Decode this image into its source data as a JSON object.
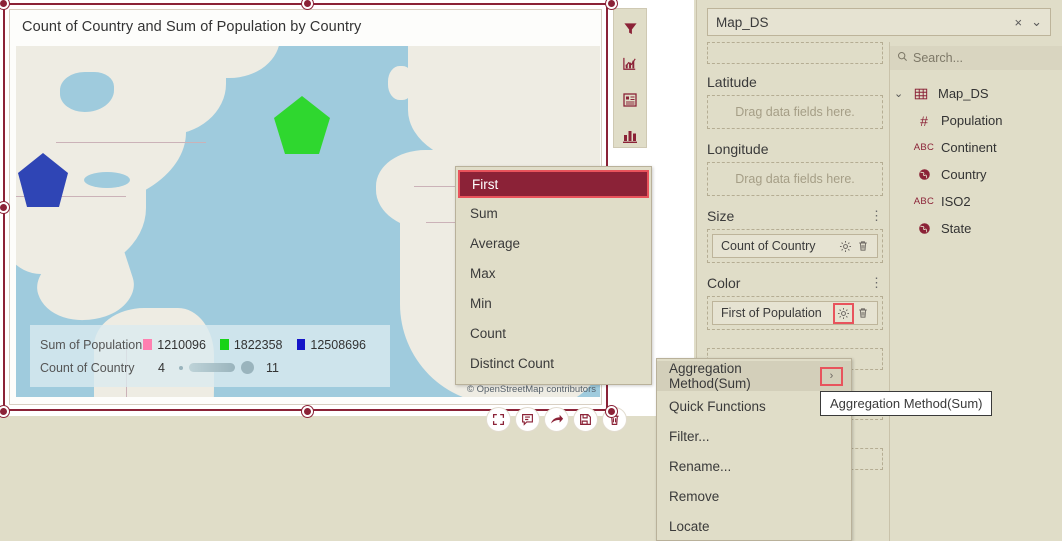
{
  "widget": {
    "title": "Count of Country and Sum of Population by Country",
    "map_attribution": "© OpenStreetMap contributors",
    "legend": {
      "color_label": "Sum of Population",
      "color_items": [
        {
          "color": "#ff7fb0",
          "value": "1210096"
        },
        {
          "color": "#17d317",
          "value": "1822358"
        },
        {
          "color": "#1414c8",
          "value": "12508696"
        }
      ],
      "size_label": "Count of Country",
      "size_min": "4",
      "size_max": "11"
    },
    "markers": [
      {
        "name": "united-states-marker",
        "color": "#2f45b5"
      },
      {
        "name": "europe-marker",
        "color": "#2fd72f"
      }
    ],
    "toolbar": [
      {
        "name": "expand-button",
        "glyph": "⛶"
      },
      {
        "name": "comment-button",
        "glyph": "▭"
      },
      {
        "name": "share-button",
        "glyph": "➜"
      },
      {
        "name": "save-button",
        "glyph": "▤"
      },
      {
        "name": "delete-button",
        "glyph": "🗑"
      }
    ]
  },
  "side_strip": [
    {
      "name": "filter-icon",
      "label": "Filter"
    },
    {
      "name": "chart-settings-icon",
      "label": "Chart settings"
    },
    {
      "name": "properties-icon",
      "label": "Properties"
    },
    {
      "name": "bar-chart-icon",
      "label": "Chart type"
    }
  ],
  "panel": {
    "dataset_select": {
      "value": "Map_DS",
      "clear": "×",
      "chevron": "⌄"
    },
    "shelves": [
      {
        "name": "geography",
        "label": "",
        "placeholder": "",
        "type": "empty-strip"
      },
      {
        "name": "latitude",
        "label": "Latitude",
        "placeholder": "Drag data fields here.",
        "type": "empty"
      },
      {
        "name": "longitude",
        "label": "Longitude",
        "placeholder": "Drag data fields here.",
        "type": "empty"
      },
      {
        "name": "size",
        "label": "Size",
        "pill": "Count of Country",
        "type": "filled",
        "highlight": false
      },
      {
        "name": "color",
        "label": "Color",
        "pill": "First of Population",
        "type": "filled",
        "highlight": true
      }
    ],
    "kebab": "⋮",
    "gear": "⚙",
    "trash": "🗑",
    "search": {
      "placeholder": "Search...",
      "icon": "search-icon"
    },
    "tree": {
      "root": {
        "label": "Map_DS",
        "icon": "table-icon",
        "chevron": "⌄"
      },
      "fields": [
        {
          "label": "Population",
          "icon": "number-icon",
          "glyph": "#"
        },
        {
          "label": "Continent",
          "icon": "text-icon",
          "glyph": "ABC"
        },
        {
          "label": "Country",
          "icon": "geo-icon",
          "glyph": "globe"
        },
        {
          "label": "ISO2",
          "icon": "text-icon",
          "glyph": "ABC"
        },
        {
          "label": "State",
          "icon": "geo-icon",
          "glyph": "globe"
        }
      ]
    }
  },
  "aggregation_menu": {
    "items": [
      {
        "label": "First",
        "selected": true
      },
      {
        "label": "Sum",
        "selected": false
      },
      {
        "label": "Average",
        "selected": false
      },
      {
        "label": "Max",
        "selected": false
      },
      {
        "label": "Min",
        "selected": false
      },
      {
        "label": "Count",
        "selected": false
      },
      {
        "label": "Distinct Count",
        "selected": false
      }
    ]
  },
  "context_menu": {
    "items": [
      {
        "label": "Aggregation Method(Sum)",
        "submenu": true,
        "hovered": true,
        "arrow": "›"
      },
      {
        "label": "Quick Functions",
        "submenu": false,
        "hovered": false
      },
      {
        "label": "Filter...",
        "submenu": false,
        "hovered": false
      },
      {
        "label": "Rename...",
        "submenu": false,
        "hovered": false
      },
      {
        "label": "Remove",
        "submenu": false,
        "hovered": false
      },
      {
        "label": "Locate",
        "submenu": false,
        "hovered": false
      }
    ]
  },
  "tooltip": {
    "text": "Aggregation Method(Sum)"
  },
  "colors": {
    "accent": "#8b2237",
    "highlight": "#e8535c",
    "panel_bg": "#e0ddc8",
    "ocean": "#9fcbdd",
    "land": "#eeece3"
  }
}
